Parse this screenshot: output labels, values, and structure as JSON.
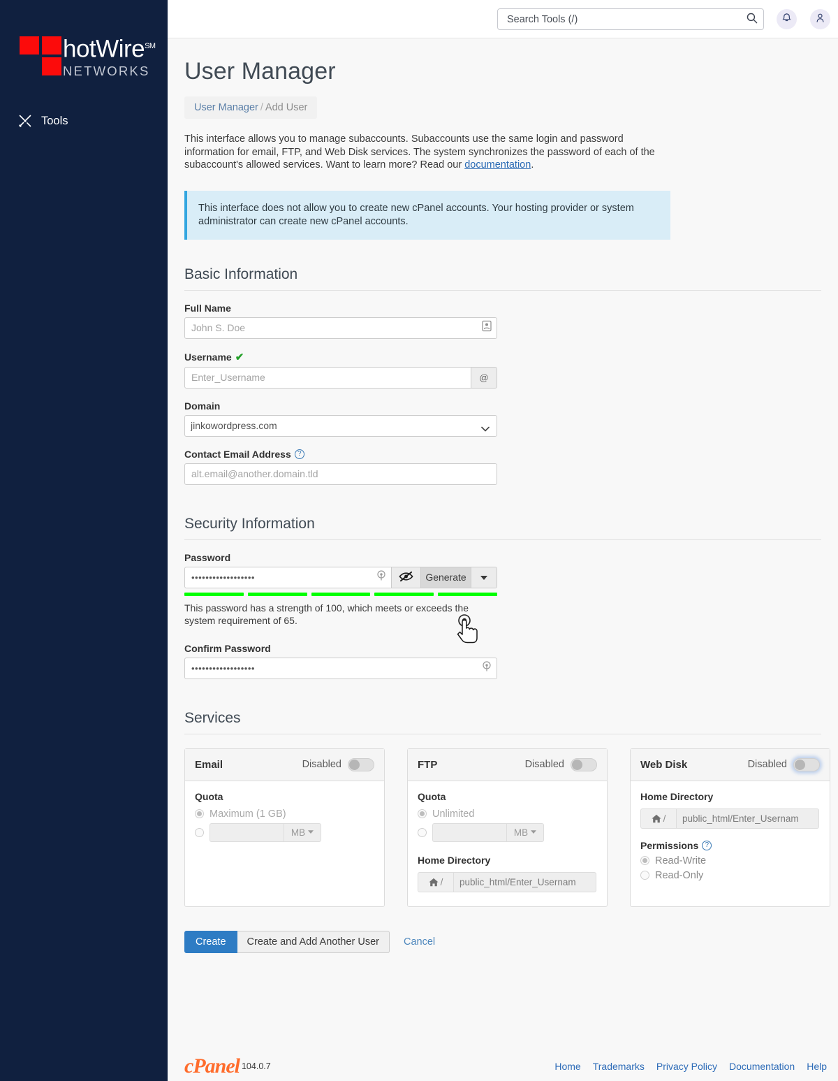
{
  "sidebar": {
    "logo": {
      "main": "hotWire",
      "sm": "SM",
      "sub": "NETWORKS"
    },
    "nav": [
      {
        "label": "Tools",
        "icon": "tools-icon"
      }
    ]
  },
  "topbar": {
    "search": {
      "placeholder": "Search Tools (/)",
      "value": "",
      "icon": "search-icon"
    },
    "notifications_icon": "bell-icon",
    "account_icon": "user-icon"
  },
  "page": {
    "title": "User Manager",
    "breadcrumb": {
      "parent": "User Manager",
      "separator": "/",
      "current": "Add User"
    },
    "intro": "This interface allows you to manage subaccounts. Subaccounts use the same login and password information for email, FTP, and Web Disk services. The system synchronizes the password of each of the subaccount's allowed services. Want to learn more? Read our ",
    "intro_link": "documentation",
    "intro_end": ".",
    "notice": "This interface does not allow you to create new cPanel accounts. Your hosting provider or system administrator can create new cPanel accounts."
  },
  "basic": {
    "heading": "Basic Information",
    "full_name": {
      "label": "Full Name",
      "placeholder": "John S. Doe",
      "value": "",
      "icon": "id-card-icon"
    },
    "username": {
      "label": "Username",
      "valid_icon": "check-icon",
      "placeholder": "Enter_Username",
      "value": "",
      "addon": "@"
    },
    "domain": {
      "label": "Domain",
      "value": "jinkowordpress.com",
      "options": [
        "jinkowordpress.com"
      ],
      "caret": "chevron-down-icon"
    },
    "contact_email": {
      "label": "Contact Email Address",
      "help_icon": "question-icon",
      "placeholder": "alt.email@another.domain.tld",
      "value": ""
    }
  },
  "security": {
    "heading": "Security Information",
    "password": {
      "label": "Password",
      "value": "••••••••••••••••••",
      "reveal_icon": "eye-slash-icon",
      "generate_label": "Generate",
      "caret_icon": "caret-down-icon",
      "strength_segments": 5,
      "strength_color": "#00ff00",
      "message": "This password has a strength of 100, which meets or exceeds the system requirement of 65."
    },
    "confirm_password": {
      "label": "Confirm Password",
      "value": "••••••••••••••••••"
    }
  },
  "services": {
    "heading": "Services",
    "cards": [
      {
        "name": "Email",
        "state": "Disabled",
        "enabled": false,
        "quota_label": "Quota",
        "quota_options": [
          {
            "label": "Maximum (1 GB)",
            "selected": true
          },
          {
            "label": "",
            "selected": false
          }
        ],
        "quota_value": "",
        "quota_unit": "MB",
        "has_home_dir": false
      },
      {
        "name": "FTP",
        "state": "Disabled",
        "enabled": false,
        "quota_label": "Quota",
        "quota_options": [
          {
            "label": "Unlimited",
            "selected": true
          },
          {
            "label": "",
            "selected": false
          }
        ],
        "quota_value": "",
        "quota_unit": "MB",
        "has_home_dir": true,
        "home_dir_label": "Home Directory",
        "home_dir_prefix": "/",
        "home_dir_value": "public_html/Enter_Usernam"
      },
      {
        "name": "Web Disk",
        "state": "Disabled",
        "enabled": false,
        "focused": true,
        "has_home_dir": true,
        "home_dir_label": "Home Directory",
        "home_dir_prefix": "/",
        "home_dir_value": "public_html/Enter_Usernam",
        "permissions_label": "Permissions",
        "permissions_help_icon": "question-icon",
        "permissions": [
          {
            "label": "Read-Write",
            "selected": true
          },
          {
            "label": "Read-Only",
            "selected": false
          }
        ]
      }
    ]
  },
  "actions": {
    "create": "Create",
    "create_another": "Create and Add Another User",
    "cancel": "Cancel"
  },
  "footer": {
    "brand": "cPanel",
    "version": "104.0.7",
    "links": [
      "Home",
      "Trademarks",
      "Privacy Policy",
      "Documentation",
      "Help"
    ]
  }
}
